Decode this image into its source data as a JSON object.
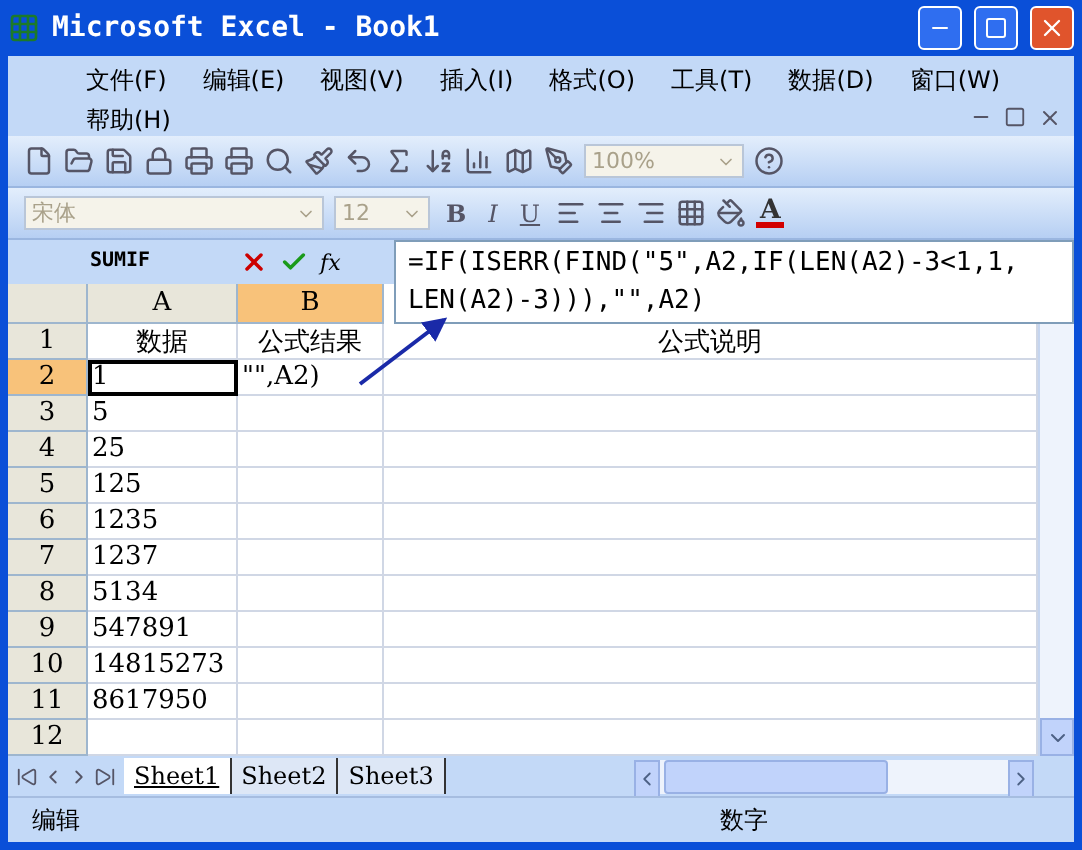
{
  "window": {
    "title": "Microsoft Excel - Book1"
  },
  "menu": [
    "文件(F)",
    "编辑(E)",
    "视图(V)",
    "插入(I)",
    "格式(O)",
    "工具(T)",
    "数据(D)",
    "窗口(W)",
    "帮助(H)"
  ],
  "standard_toolbar": {
    "zoom": "100%"
  },
  "formatting_toolbar": {
    "font": "宋体",
    "size": "12",
    "bold": "B",
    "italic": "I",
    "underline": "U",
    "font_color": "A"
  },
  "formula_bar": {
    "name_box": "SUMIF",
    "function_button": "fx",
    "lines": [
      "=IF(ISERR(FIND(\"5\",A2,IF(LEN(A2)-3<1,1,",
      "LEN(A2)-3))),\"\",A2)"
    ]
  },
  "sheet": {
    "columns": [
      {
        "label": "A",
        "selected": false
      },
      {
        "label": "B",
        "selected": true
      }
    ],
    "rows": [
      {
        "label": "1",
        "selected": false,
        "cells": [
          "数据",
          "公式结果",
          "公式说明"
        ]
      },
      {
        "label": "2",
        "selected": true,
        "cells": [
          "1",
          "\"\",A2)",
          ""
        ]
      },
      {
        "label": "3",
        "selected": false,
        "cells": [
          "5",
          "",
          ""
        ]
      },
      {
        "label": "4",
        "selected": false,
        "cells": [
          "25",
          "",
          ""
        ]
      },
      {
        "label": "5",
        "selected": false,
        "cells": [
          "125",
          "",
          ""
        ]
      },
      {
        "label": "6",
        "selected": false,
        "cells": [
          "1235",
          "",
          ""
        ]
      },
      {
        "label": "7",
        "selected": false,
        "cells": [
          "1237",
          "",
          ""
        ]
      },
      {
        "label": "8",
        "selected": false,
        "cells": [
          "5134",
          "",
          ""
        ]
      },
      {
        "label": "9",
        "selected": false,
        "cells": [
          "547891",
          "",
          ""
        ]
      },
      {
        "label": "10",
        "selected": false,
        "cells": [
          "14815273",
          "",
          ""
        ]
      },
      {
        "label": "11",
        "selected": false,
        "cells": [
          "8617950",
          "",
          ""
        ]
      },
      {
        "label": "12",
        "selected": false,
        "cells": [
          "",
          "",
          ""
        ]
      }
    ]
  },
  "sheet_tabs": [
    {
      "label": "Sheet1",
      "selected": true
    },
    {
      "label": "Sheet2",
      "selected": false
    },
    {
      "label": "Sheet3",
      "selected": false
    }
  ],
  "status_bar": {
    "mode": "编辑",
    "indicator": "数字"
  }
}
